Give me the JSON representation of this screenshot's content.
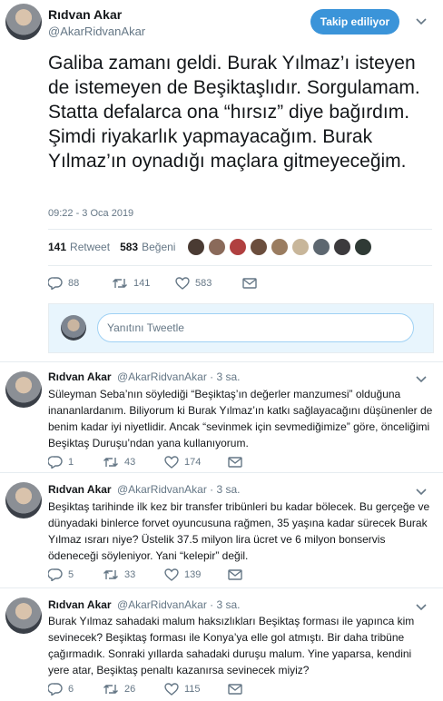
{
  "main": {
    "author_name": "Rıdvan Akar",
    "author_handle": "@AkarRidvanAkar",
    "follow_label": "Takip ediliyor",
    "text": "Galiba zamanı geldi. Burak Yılmaz’ı isteyen de istemeyen de Beşiktaşlıdır. Sorgulamam. Statta defalarca ona “hırsız” diye bağırdım. Şimdi riyakarlık yapmayacağım. Burak Yılmaz’ın oynadığı maçlara gitmeyeceğim.",
    "timestamp": "09:22 - 3 Oca 2019",
    "retweets_count": "141",
    "retweets_label": "Retweet",
    "likes_count": "583",
    "likes_label": "Beğeni",
    "actions": {
      "replies": "88",
      "retweets": "141",
      "likes": "583"
    }
  },
  "reply_box": {
    "placeholder": "Yanıtını Tweetle"
  },
  "replies": [
    {
      "name": "Rıdvan Akar",
      "handle": "@AkarRidvanAkar · 3 sa.",
      "text": "Süleyman Seba’nın söylediği “Beşiktaş’ın değerler manzumesi” olduğuna inananlardanım. Biliyorum ki Burak Yılmaz’ın katkı sağlayacağını düşünenler de benim kadar iyi niyetlidir. Ancak “sevinmek için sevmediğimize” göre, önceliğimi Beşiktaş Duruşu’ndan yana kullanıyorum.",
      "replies": "1",
      "retweets": "43",
      "likes": "174"
    },
    {
      "name": "Rıdvan Akar",
      "handle": "@AkarRidvanAkar · 3 sa.",
      "text": "Beşiktaş tarihinde ilk kez bir transfer tribünleri bu kadar bölecek. Bu gerçeğe ve dünyadaki binlerce forvet oyuncusuna rağmen, 35 yaşına kadar sürecek Burak Yılmaz ısrarı niye? Üstelik 37.5 milyon lira ücret ve 6 milyon bonservis ödeneceği söyleniyor. Yani “kelepir” değil.",
      "replies": "5",
      "retweets": "33",
      "likes": "139"
    },
    {
      "name": "Rıdvan Akar",
      "handle": "@AkarRidvanAkar · 3 sa.",
      "text": "Burak Yılmaz sahadaki malum haksızlıkları Beşiktaş forması ile yapınca kim sevinecek? Beşiktaş forması ile Konya’ya elle gol atmıştı. Bir daha tribüne çağırmadık. Sonraki yıllarda sahadaki duruşu malum. Yine yaparsa, kendini yere atar, Beşiktaş penaltı kazanırsa sevinecek miyiz?",
      "replies": "6",
      "retweets": "26",
      "likes": "115"
    }
  ],
  "icons": {
    "reply": "reply-icon",
    "retweet": "retweet-icon",
    "like": "heart-icon",
    "dm": "envelope-icon",
    "caret": "chevron-down-icon"
  },
  "colors": {
    "follow_button": "#3b94d9",
    "secondary_text": "#657786",
    "reply_band": "#e8f5fd"
  }
}
